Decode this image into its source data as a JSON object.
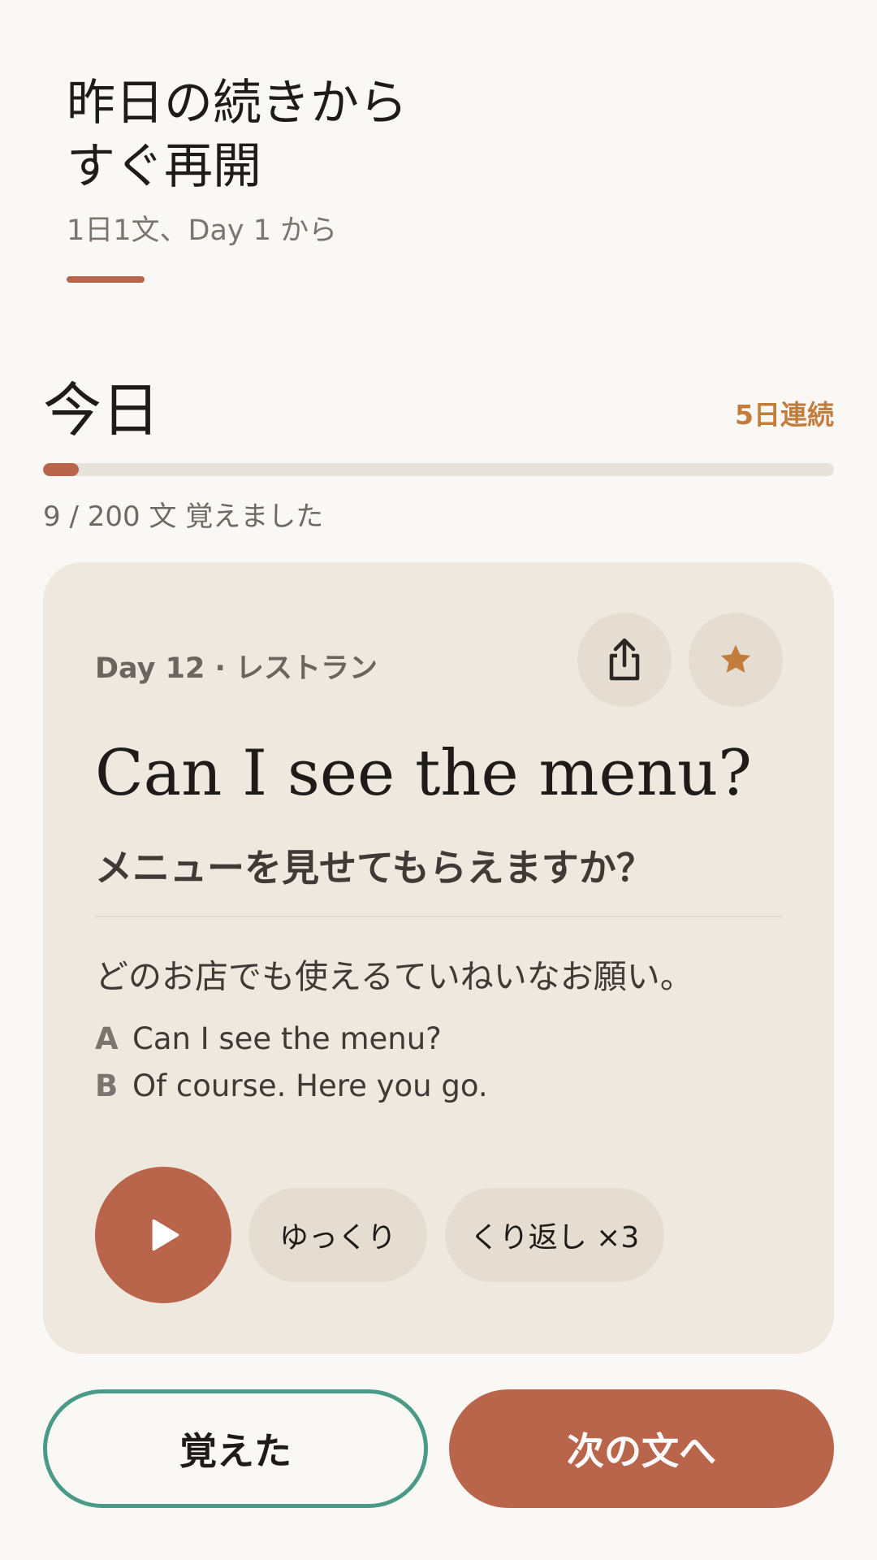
{
  "header": {
    "title": "昨日の続きから\nすぐ再開",
    "subtitle": "1日1文、Day 1 から"
  },
  "today": {
    "title": "今日",
    "streak": "5日連続",
    "progress_text": "9 / 200 文 覚えました",
    "progress_value": 0.045
  },
  "card": {
    "meta": "Day 12 · レストラン",
    "phrase_en": "Can I see the menu?",
    "phrase_jp": "メニューを見せてもらえますか？",
    "note": "どのお店でも使えるていねいなお願い。",
    "dialog": [
      {
        "speaker": "A",
        "text": "Can I see the menu?"
      },
      {
        "speaker": "B",
        "text": "Of course. Here you go."
      }
    ],
    "chips": {
      "slow": "ゆっくり",
      "repeat": "くり返し ×3"
    },
    "icons": {
      "share": "share-icon",
      "star": "star-icon",
      "play": "play-icon"
    }
  },
  "actions": {
    "memorized": "覚えた",
    "next": "次の文へ"
  },
  "colors": {
    "accent": "#b9654b",
    "streak": "#c27d3c",
    "outline": "#4a9a88",
    "card_bg": "#efe8de"
  }
}
